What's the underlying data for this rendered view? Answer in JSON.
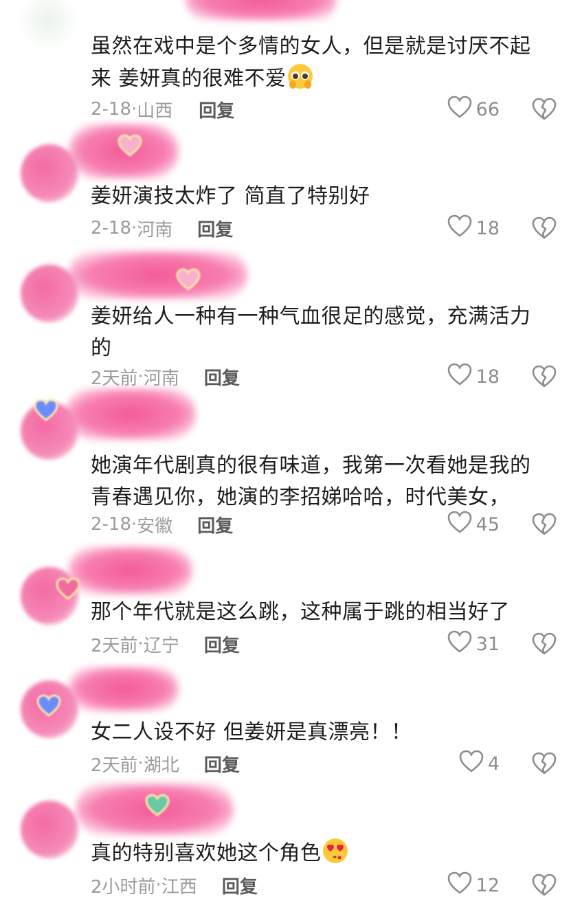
{
  "comments": [
    {
      "text": "虽然在戏中是个多情的女人，但是就是讨厌不起来 姜妍真的很难不爱",
      "emoji": "pleading-face-emoji",
      "date": "2-18",
      "location": "山西",
      "reply_label": "回复",
      "likes": "66"
    },
    {
      "text": "姜妍演技太炸了 简直了特别好",
      "emoji": "",
      "date": "2-18",
      "location": "河南",
      "reply_label": "回复",
      "likes": "18"
    },
    {
      "text": "姜妍给人一种有一种气血很足的感觉，充满活力的",
      "emoji": "",
      "date": "2天前",
      "location": "河南",
      "reply_label": "回复",
      "likes": "18"
    },
    {
      "text": "她演年代剧真的很有味道，我第一次看她是我的青春遇见你，她演的李招娣哈哈，时代美女，",
      "emoji": "",
      "date": "2-18",
      "location": "安徽",
      "reply_label": "回复",
      "likes": "45"
    },
    {
      "text": "那个年代就是这么跳，这种属于跳的相当好了",
      "emoji": "",
      "date": "2天前",
      "location": "辽宁",
      "reply_label": "回复",
      "likes": "31"
    },
    {
      "text": "女二人设不好 但姜妍是真漂亮！！",
      "emoji": "",
      "date": "2天前",
      "location": "湖北",
      "reply_label": "回复",
      "likes": "4"
    },
    {
      "text": "真的特别喜欢她这个角色",
      "emoji": "heart-eyes-emoji",
      "date": "2小时前",
      "location": "江西",
      "reply_label": "回复",
      "likes": "12"
    }
  ],
  "icons": {
    "like": "heart-outline-icon",
    "dislike": "broken-heart-icon"
  },
  "colors": {
    "text": "#1d1d1d",
    "meta": "#9b9b9b",
    "reply": "#5a5a5a",
    "icon": "#8c8c8c",
    "blur": "#f35a98"
  }
}
